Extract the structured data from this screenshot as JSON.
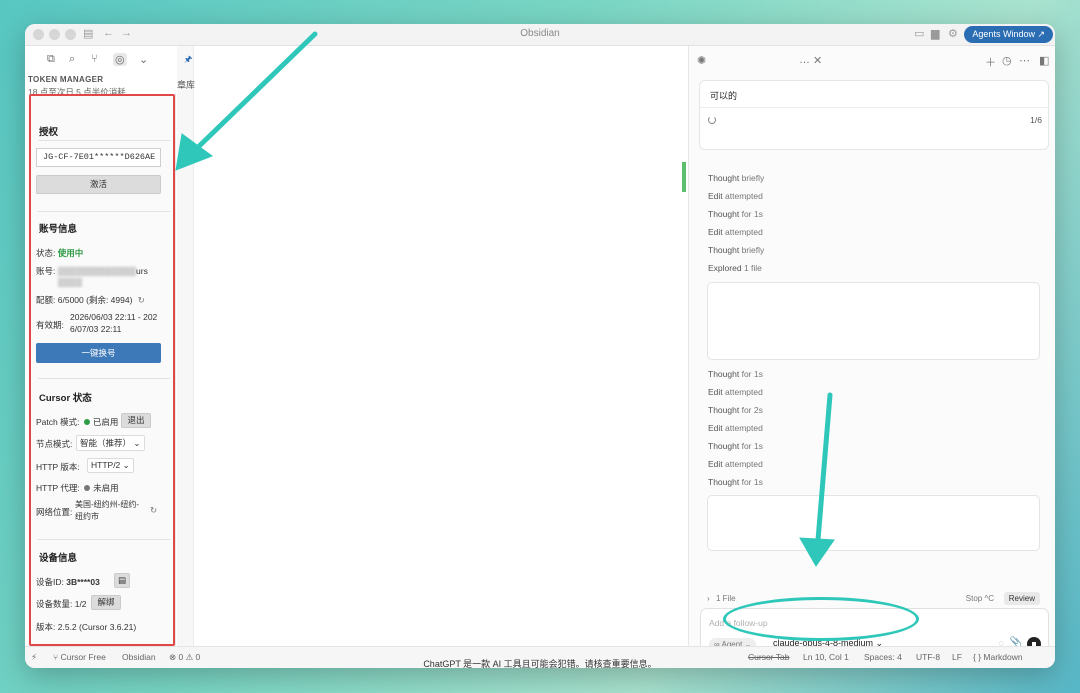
{
  "window": {
    "title": "Obsidian",
    "agents_button": "Agents Window ↗"
  },
  "token_manager": {
    "title": "TOKEN MANAGER",
    "notice": "18 点至次日 5 点半价消耗",
    "auth": {
      "heading": "授权",
      "license_value": "JG-CF-7E01******D626AE",
      "activate_label": "激活"
    },
    "account": {
      "heading": "账号信息",
      "status_label": "状态:",
      "status_value": "使用中",
      "account_label": "账号:",
      "account_value": "urs",
      "quota_label": "配额:",
      "quota_value": "6/5000 (剩余: 4994)",
      "validity_label": "有效期:",
      "validity_value_1": "2026/06/03 22:11 - 202",
      "validity_value_2": "6/07/03 22:11",
      "switch_label": "一键换号"
    },
    "cursor_state": {
      "heading": "Cursor 状态",
      "patch_label": "Patch 模式:",
      "patch_value": "已启用",
      "exit_label": "退出",
      "node_label": "节点模式:",
      "node_value": "智能（推荐）",
      "http_version_label": "HTTP 版本:",
      "http_version_value": "HTTP/2",
      "http_proxy_label": "HTTP 代理:",
      "http_proxy_value": "未启用",
      "location_label": "网络位置:",
      "location_value_1": "美国-纽约州-纽约-",
      "location_value_2": "纽约市"
    },
    "device": {
      "heading": "设备信息",
      "device_id_label": "设备ID:",
      "device_id_value": "3B****03",
      "device_count_label": "设备数量: 1/2",
      "unbind_label": "解绑",
      "version_label": "版本:",
      "version_value": "2.5.2 (Cursor 3.6.21)"
    }
  },
  "editor": {
    "chapter_text": "章库"
  },
  "chat": {
    "message": "可以的",
    "progress": "1/6",
    "steps_top": [
      {
        "a": "Thought",
        "b": "briefly"
      },
      {
        "a": "Edit",
        "b": "attempted"
      },
      {
        "a": "Thought",
        "b": "for 1s"
      },
      {
        "a": "Edit",
        "b": "attempted"
      },
      {
        "a": "Thought",
        "b": "briefly"
      },
      {
        "a": "Explored",
        "b": "1 file"
      }
    ],
    "steps_bottom": [
      {
        "a": "Thought",
        "b": "for 1s"
      },
      {
        "a": "Edit",
        "b": "attempted"
      },
      {
        "a": "Thought",
        "b": "for 2s"
      },
      {
        "a": "Edit",
        "b": "attempted"
      },
      {
        "a": "Thought",
        "b": "for 1s"
      },
      {
        "a": "Edit",
        "b": "attempted"
      },
      {
        "a": "Thought",
        "b": "for 1s"
      }
    ],
    "files_label": "1 File",
    "stop_label": "Stop ^C",
    "review_label": "Review",
    "compose_placeholder": "Add a follow-up",
    "agent_chip": "∞ Agent ⌄",
    "model": "claude-opus-4-8-medium ⌄"
  },
  "statusbar": {
    "cursor_free": "Cursor Free",
    "obsidian": "Obsidian",
    "problems": "⊗ 0 ⚠ 0",
    "cursor_tab": "Cursor Tab",
    "position": "Ln 10, Col 1",
    "spaces": "Spaces: 4",
    "encoding": "UTF-8",
    "eol": "LF",
    "language": "{ } Markdown"
  },
  "footer": {
    "disclaimer": "ChatGPT 是一款 AI 工具且可能会犯错。请核查重要信息。"
  },
  "colors": {
    "accent": "#2b6db3",
    "highlight_box": "#e04848",
    "annotation_arrow": "#2fc7b9",
    "status_green": "#2e9b45"
  }
}
